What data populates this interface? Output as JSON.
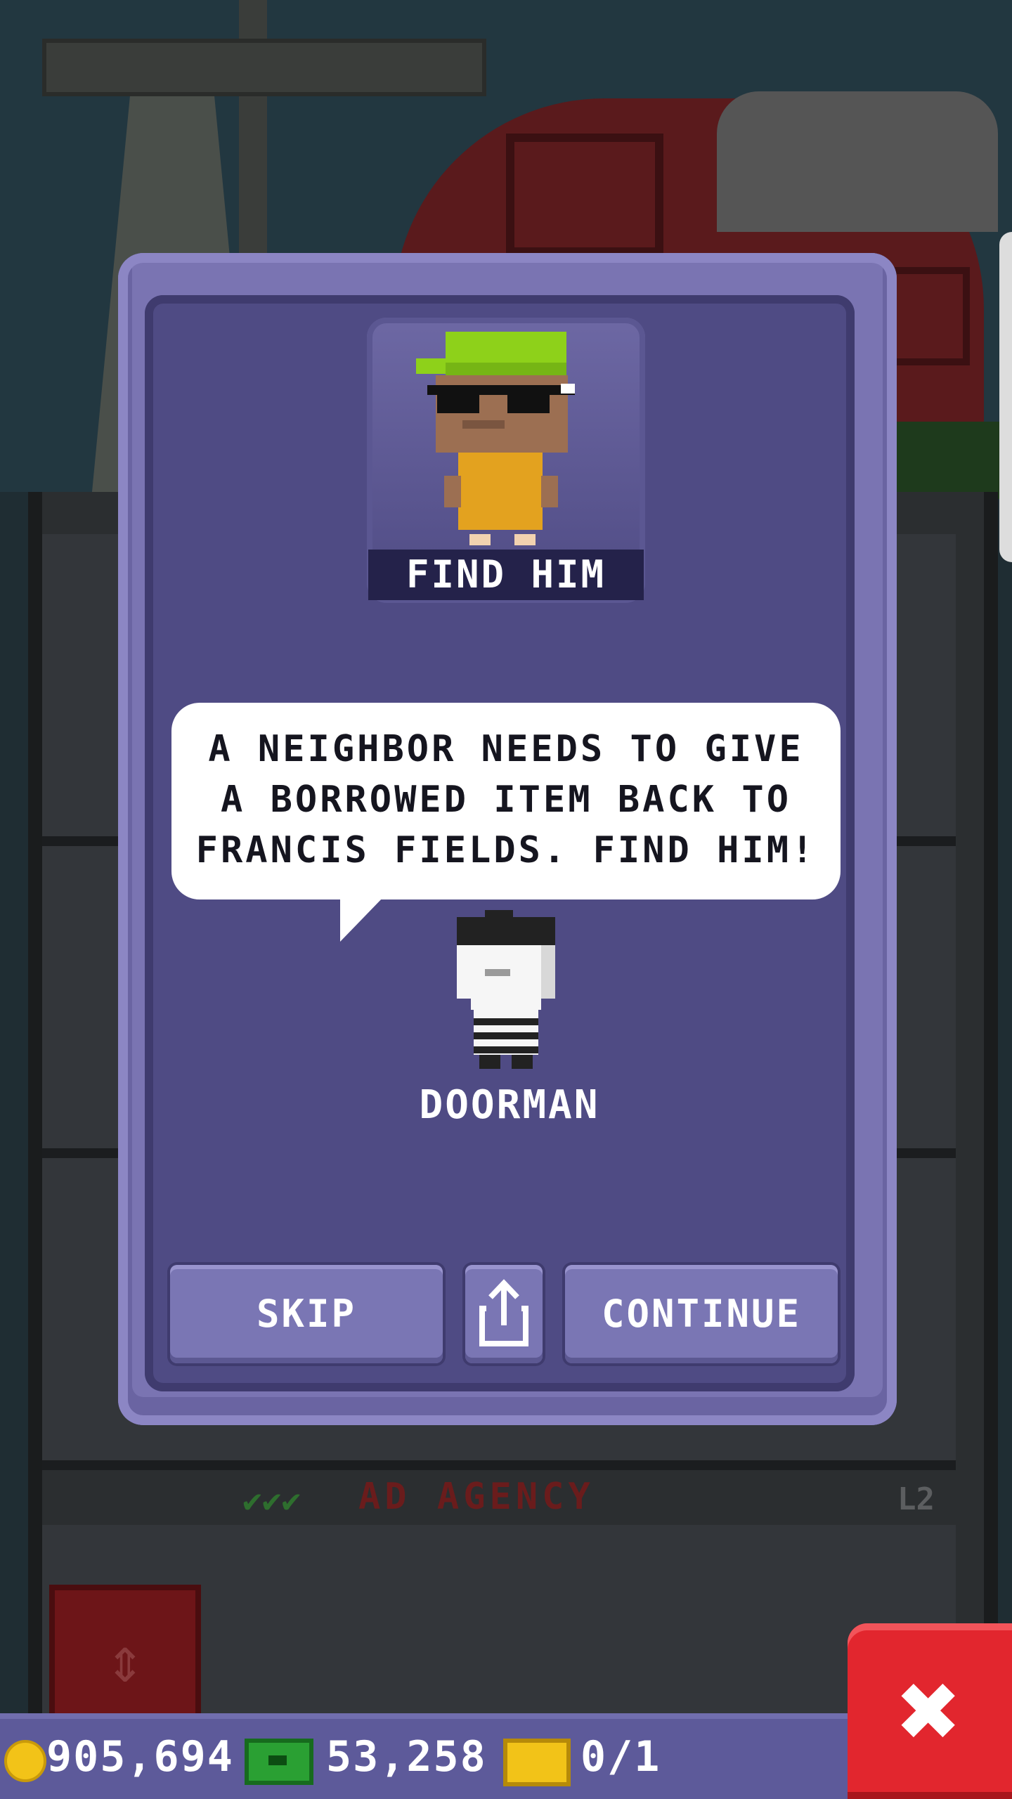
{
  "mission": {
    "title": "FIND HIM",
    "speech_lines": [
      "A NEIGHBOR NEEDS TO GIVE",
      "A BORROWED ITEM BACK TO",
      "FRANCIS FIELDS. FIND HIM!"
    ],
    "speaker_name": "DOORMAN"
  },
  "buttons": {
    "skip_label": "SKIP",
    "share_icon": "share-icon",
    "continue_label": "CONTINUE",
    "close_icon": "close-icon"
  },
  "background": {
    "floor_label": "AD AGENCY",
    "floor_level": "L2",
    "checks": "✔✔✔"
  },
  "status_bar": {
    "coins": "905,694",
    "bux": "53,258",
    "tickets": "0/1",
    "coin_icon": "coin-icon",
    "bux_icon": "bux-icon",
    "ticket_icon": "ticket-icon"
  },
  "colors": {
    "modal": "#7a74b2",
    "modal_inner": "#4f4b84",
    "button": "#7a76b4",
    "close": "#e2262e",
    "coin": "#f2c318",
    "bux": "#2aa033"
  }
}
